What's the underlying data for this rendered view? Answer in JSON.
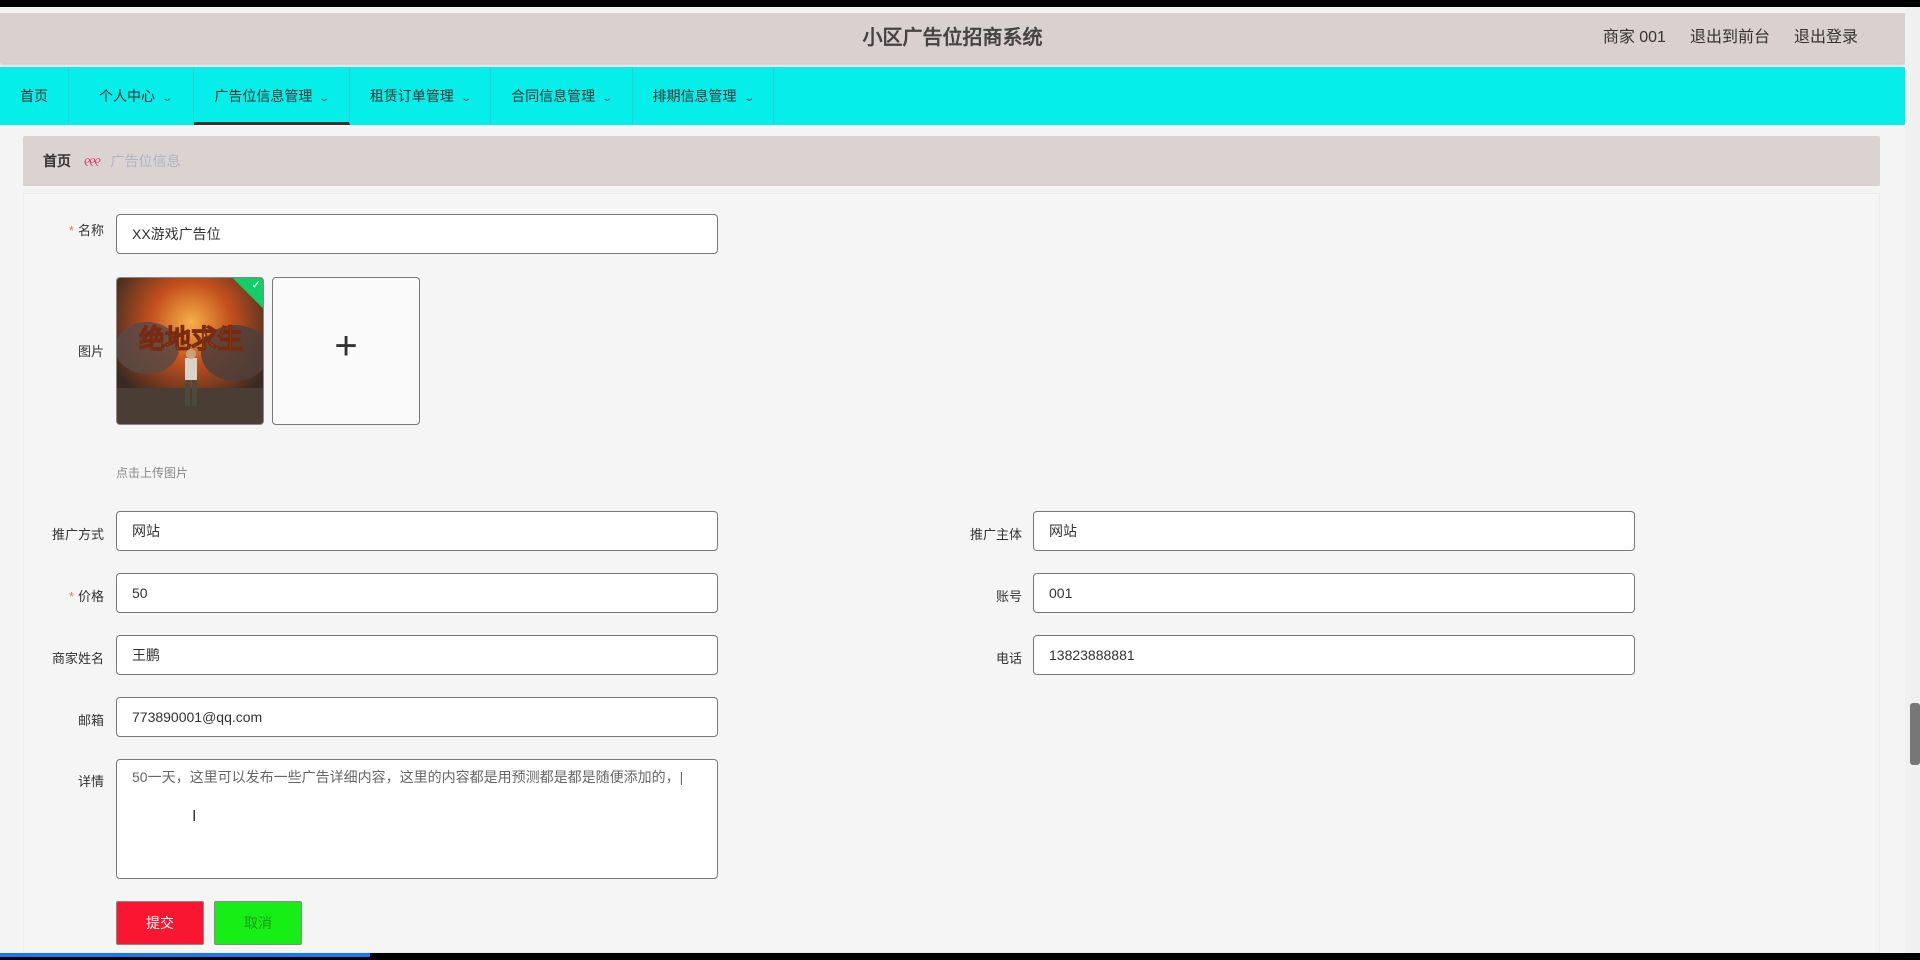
{
  "header": {
    "title": "小区广告位招商系统",
    "user": "商家 001",
    "to_front": "退出到前台",
    "logout": "退出登录"
  },
  "nav": {
    "items": [
      {
        "label": "首页"
      },
      {
        "label": "个人中心"
      },
      {
        "label": "广告位信息管理"
      },
      {
        "label": "租赁订单管理"
      },
      {
        "label": "合同信息管理"
      },
      {
        "label": "排期信息管理"
      }
    ]
  },
  "breadcrumb": {
    "home": "首页",
    "separator": "୧୧୧",
    "current": "广告位信息"
  },
  "form": {
    "name_label": "名称",
    "name_value": "XX游戏广告位",
    "image_label": "图片",
    "upload_hint": "点击上传图片",
    "method_label": "推广方式",
    "method_value": "网站",
    "subject_label": "推广主体",
    "subject_value": "网站",
    "price_label": "价格",
    "price_value": "50",
    "account_label": "账号",
    "account_value": "001",
    "merchant_label": "商家姓名",
    "merchant_value": "王鹏",
    "phone_label": "电话",
    "phone_value": "13823888881",
    "email_label": "邮箱",
    "email_value": "773890001@qq.com",
    "detail_label": "详情",
    "detail_value": "50一天，这里可以发布一些广告详细内容，这里的内容都是用预测都是都是随便添加的，|",
    "submit_label": "提交",
    "cancel_label": "取消"
  },
  "colors": {
    "nav_bg": "#06eeea",
    "header_bg": "#d9d0d0",
    "submit_bg": "#fa1631",
    "cancel_bg": "#16ee16"
  }
}
